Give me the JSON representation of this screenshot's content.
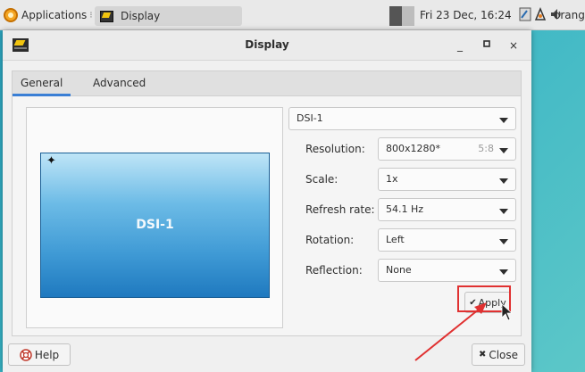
{
  "panel": {
    "applications_label": "Applications",
    "task_label": "Display",
    "clock": "Fri 23 Dec, 16:24",
    "user": "orange"
  },
  "window": {
    "title": "Display",
    "minimize": "_",
    "maximize": "□",
    "close": "×"
  },
  "tabs": [
    {
      "label": "General",
      "active": true
    },
    {
      "label": "Advanced",
      "active": false
    }
  ],
  "preview": {
    "monitor_label": "DSI-1",
    "primary_marker": "✦"
  },
  "display_select": {
    "value": "DSI-1"
  },
  "fields": {
    "resolution": {
      "label": "Resolution:",
      "value": "800x1280*",
      "hint": "5:8"
    },
    "scale": {
      "label": "Scale:",
      "value": "1x"
    },
    "refresh": {
      "label": "Refresh rate:",
      "value": "54.1 Hz"
    },
    "rotation": {
      "label": "Rotation:",
      "value": "Left"
    },
    "reflection": {
      "label": "Reflection:",
      "value": "None"
    }
  },
  "buttons": {
    "apply": "Apply",
    "apply_icon": "✔",
    "help": "Help",
    "close": "Close",
    "close_icon": "✖"
  },
  "colors": {
    "accent_tab": "#3a7fd5",
    "annotation": "#e03131"
  }
}
